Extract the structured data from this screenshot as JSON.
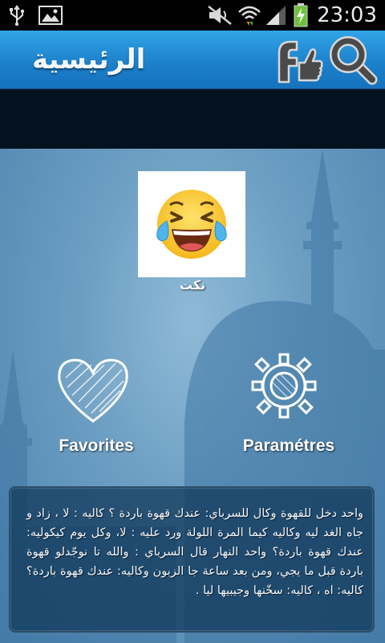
{
  "status_bar": {
    "time": "23:03",
    "icons": [
      "usb-icon",
      "image-icon",
      "mute-icon",
      "wifi-icon",
      "signal-icon",
      "battery-charging-icon"
    ]
  },
  "action_bar": {
    "title": "الرئيسية",
    "facebook_like_icon": "facebook-like-icon",
    "search_icon": "search-icon"
  },
  "colors": {
    "action_bar": "#1b7fc9",
    "banner": "#04121f",
    "background": "#6d9fc3",
    "panel": "#0e3456"
  },
  "menu": {
    "jokes": {
      "label": "نكت",
      "icon": "laughing-emoji-icon"
    },
    "favorites": {
      "label": "Favorites",
      "icon": "heart-icon"
    },
    "settings": {
      "label": "Paramétres",
      "icon": "gear-icon"
    }
  },
  "joke": {
    "text": "واحد دخل للقهوة وكال للسرباي: عندك قهوة باردة ؟ كاليه : لا ، زاد و جاه الغد ليه وكاليه كيما المرة اللولة ورد عليه : لا، وكل يوم كيكوليه: عندك قهوة باردة؟ واحد النهار قال السرباي : والله تا نوجّدلو قهوة باردة قبل ما يجي، ومن بعد ساعة جا الزبون وكاليه: عندك قهوة باردة؟ كاليه: اه ، كاليه: سخّنها وجيبيها ليا ."
  }
}
